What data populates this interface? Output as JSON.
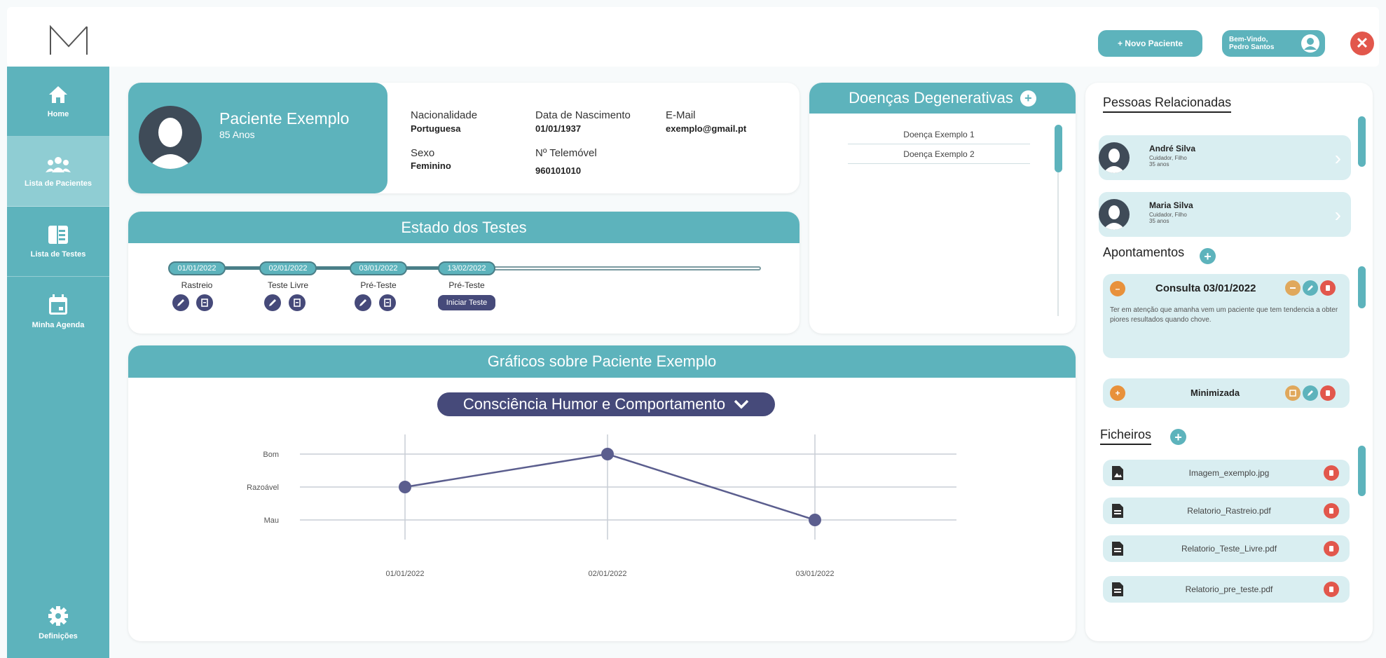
{
  "header": {
    "new_patient_label": "+ Novo Paciente",
    "welcome_line1": "Bem-Vindo,",
    "welcome_line2": "Pedro Santos"
  },
  "sidebar": {
    "items": [
      {
        "label": "Home",
        "icon": "home-icon"
      },
      {
        "label": "Lista de Pacientes",
        "icon": "users-icon"
      },
      {
        "label": "Lista de Testes",
        "icon": "list-icon"
      },
      {
        "label": "Minha Agenda",
        "icon": "calendar-icon"
      }
    ],
    "settings_label": "Definições"
  },
  "patient": {
    "name": "Paciente Exemplo",
    "age": "85 Anos",
    "fields": [
      {
        "label": "Nacionalidade",
        "value": "Portuguesa"
      },
      {
        "label": "Data de Nascimento",
        "value": "01/01/1937"
      },
      {
        "label": "E-Mail",
        "value": "exemplo@gmail.pt"
      },
      {
        "label": "Sexo",
        "value": "Feminino"
      },
      {
        "label": "Nº Telemóvel",
        "value": "960101010"
      }
    ]
  },
  "tests": {
    "title": "Estado dos Testes",
    "steps": [
      {
        "date": "01/01/2022",
        "name": "Rastreio"
      },
      {
        "date": "02/01/2022",
        "name": "Teste Livre"
      },
      {
        "date": "03/01/2022",
        "name": "Pré-Teste"
      },
      {
        "date": "13/02/2022",
        "name": "Pré-Teste"
      }
    ],
    "start_label": "Iniciar Teste"
  },
  "diseases": {
    "title": "Doenças Degenerativas",
    "items": [
      "Doença Exemplo 1",
      "Doença Exemplo 2"
    ]
  },
  "charts": {
    "title": "Gráficos sobre Paciente Exemplo",
    "dropdown_label": "Consciência Humor e Comportamento"
  },
  "chart_data": {
    "type": "line",
    "title": "",
    "xlabel": "",
    "ylabel": "",
    "categories": [
      "01/01/2022",
      "02/01/2022",
      "03/01/2022"
    ],
    "y_levels": [
      "Mau",
      "Razoável",
      "Bom"
    ],
    "values": [
      "Razoável",
      "Bom",
      "Mau"
    ],
    "grid": true,
    "line_color": "#5b5e8e"
  },
  "related": {
    "title": "Pessoas Relacionadas",
    "people": [
      {
        "name": "André Silva",
        "relation": "Cuidador, Filho",
        "age": "35 anos"
      },
      {
        "name": "Maria Silva",
        "relation": "Cuidador, Filho",
        "age": "35 anos"
      }
    ]
  },
  "appointments": {
    "title": "Apontamentos",
    "items": [
      {
        "title": "Consulta 03/01/2022",
        "text": "Ter em atenção que amanha vem um paciente que tem tendencia a obter piores resultados quando chove."
      },
      {
        "title": "Minimizada"
      }
    ]
  },
  "files": {
    "title": "Ficheiros",
    "items": [
      "Imagem_exemplo.jpg",
      "Relatorio_Rastreio.pdf",
      "Relatorio_Teste_Livre.pdf",
      "Relatorio_pre_teste.pdf"
    ]
  },
  "colors": {
    "accent": "#5db3bc",
    "dark": "#464a7a",
    "danger": "#e2574c",
    "warning": "#e8913b"
  }
}
